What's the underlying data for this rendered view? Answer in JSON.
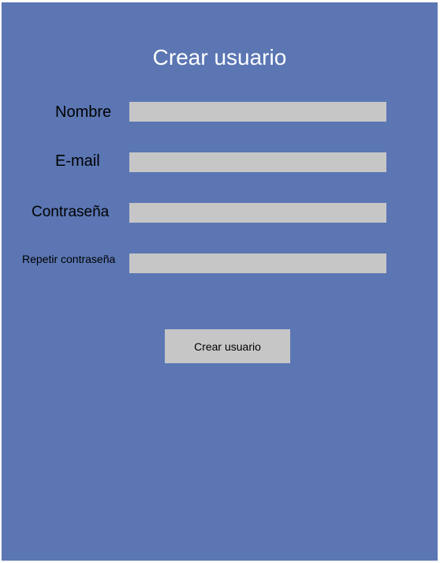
{
  "form": {
    "title": "Crear usuario",
    "fields": {
      "nombre": {
        "label": "Nombre",
        "value": "",
        "placeholder": ""
      },
      "email": {
        "label": "E-mail",
        "value": "",
        "placeholder": ""
      },
      "password": {
        "label": "Contraseña",
        "value": "",
        "placeholder": ""
      },
      "password_repeat": {
        "label": "Repetir contraseña",
        "value": "",
        "placeholder": ""
      }
    },
    "submit_label": "Crear usuario"
  },
  "colors": {
    "background": "#5b76b3",
    "title": "#ffffff",
    "input_fill": "#c6c6c6",
    "button_fill": "#c6c6c6"
  }
}
